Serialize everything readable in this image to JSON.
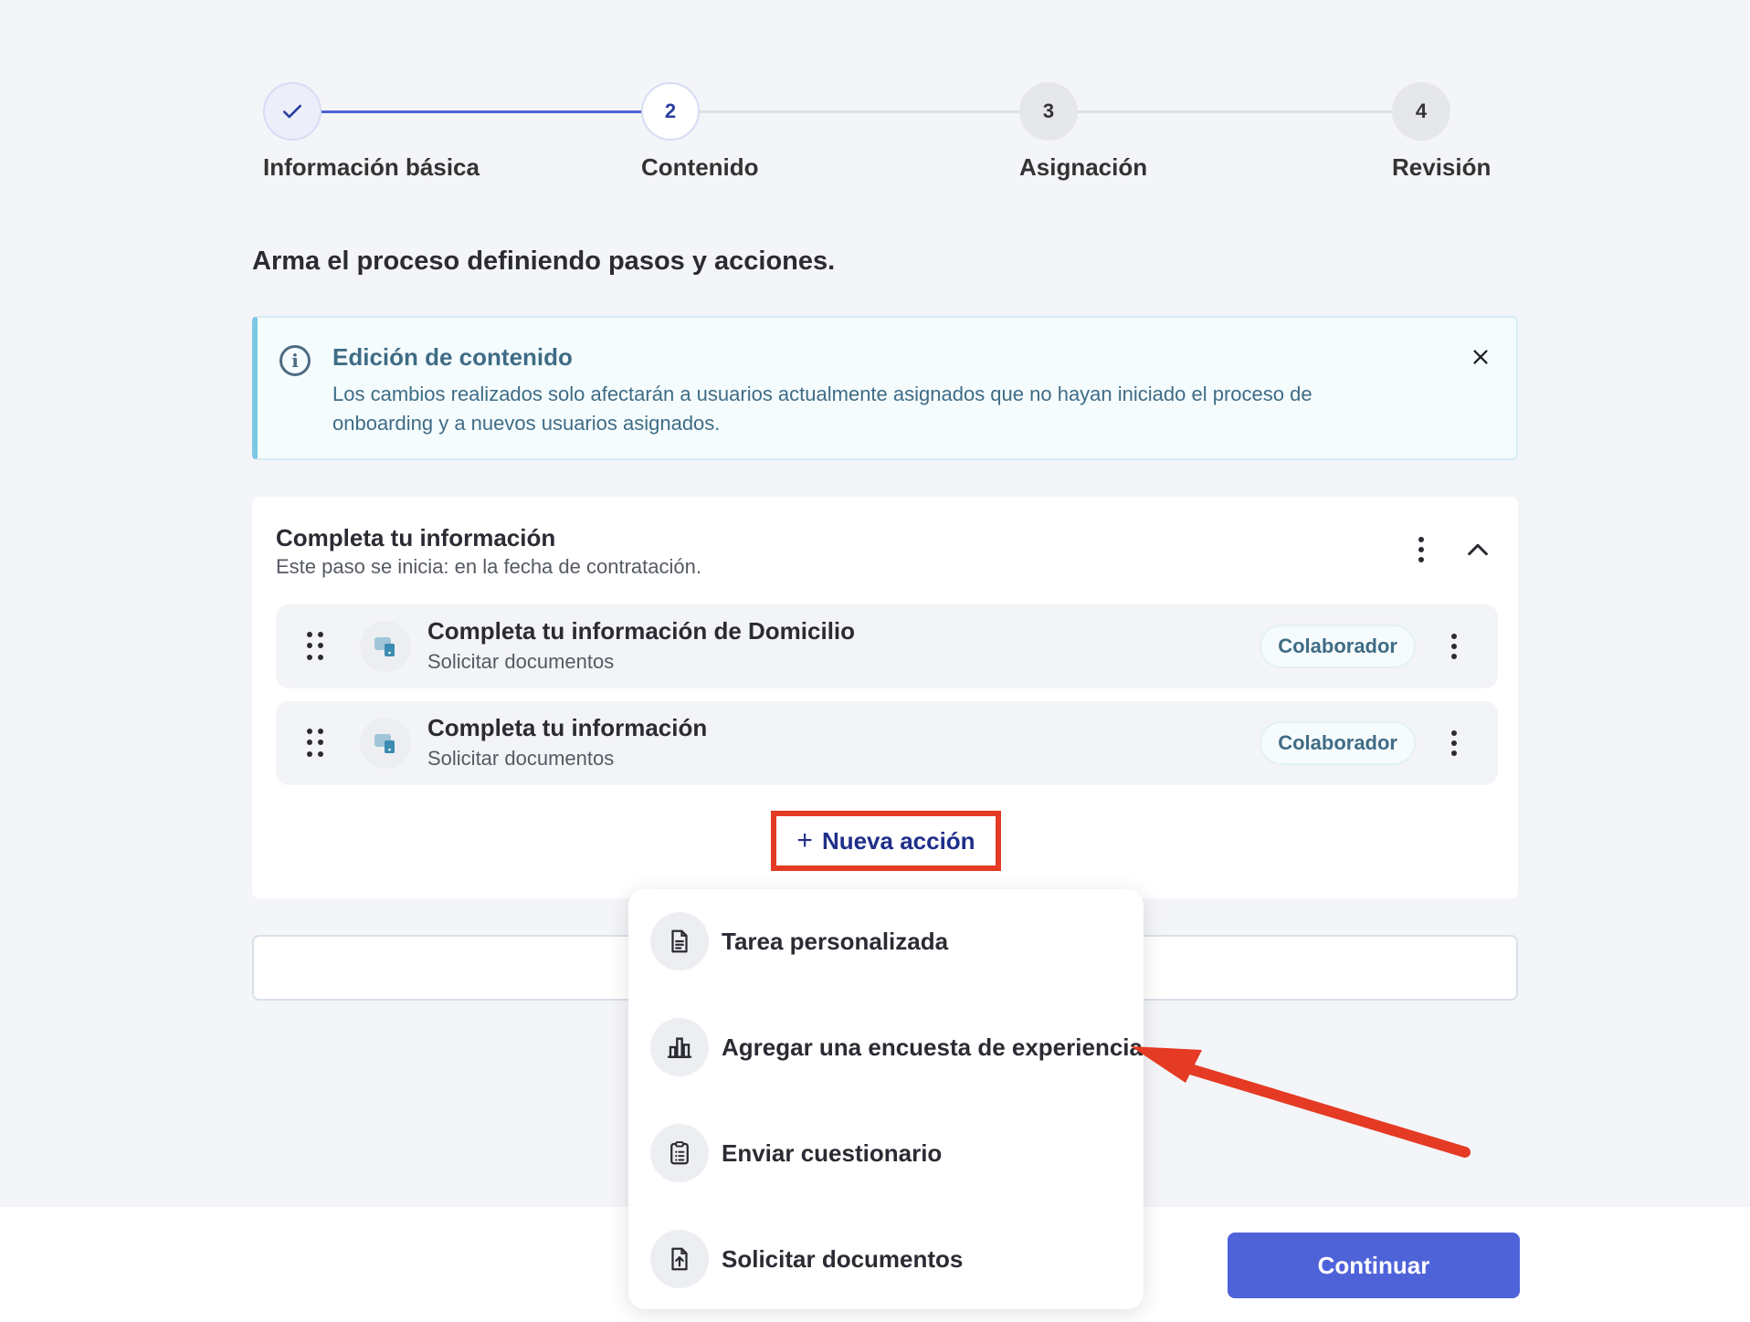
{
  "stepper": {
    "steps": [
      {
        "number": "",
        "label": "Información básica",
        "state": "done"
      },
      {
        "number": "2",
        "label": "Contenido",
        "state": "active"
      },
      {
        "number": "3",
        "label": "Asignación",
        "state": "todo"
      },
      {
        "number": "4",
        "label": "Revisión",
        "state": "todo"
      }
    ]
  },
  "page": {
    "subtitle": "Arma el proceso definiendo pasos y acciones."
  },
  "banner": {
    "title": "Edición de contenido",
    "text": "Los cambios realizados solo afectarán a usuarios actualmente asignados que no hayan iniciado el proceso de onboarding y a nuevos usuarios asignados."
  },
  "step_card": {
    "title": "Completa tu información",
    "subtitle": "Este paso se inicia: en la fecha de contratación.",
    "actions": [
      {
        "title": "Completa tu información de Domicilio",
        "type": "Solicitar documentos",
        "badge": "Colaborador"
      },
      {
        "title": "Completa tu información",
        "type": "Solicitar documentos",
        "badge": "Colaborador"
      }
    ],
    "new_action_label": "Nueva acción"
  },
  "dropdown": {
    "items": [
      {
        "label": "Tarea personalizada",
        "icon": "document-icon"
      },
      {
        "label": "Agregar una encuesta de experiencia",
        "icon": "bar-chart-icon"
      },
      {
        "label": "Enviar cuestionario",
        "icon": "clipboard-icon"
      },
      {
        "label": "Solicitar documentos",
        "icon": "file-upload-icon"
      }
    ]
  },
  "footer": {
    "continue_label": "Continuar"
  },
  "colors": {
    "accent": "#4f63d9",
    "annotation": "#e53a24",
    "banner_text": "#3f6c85"
  }
}
